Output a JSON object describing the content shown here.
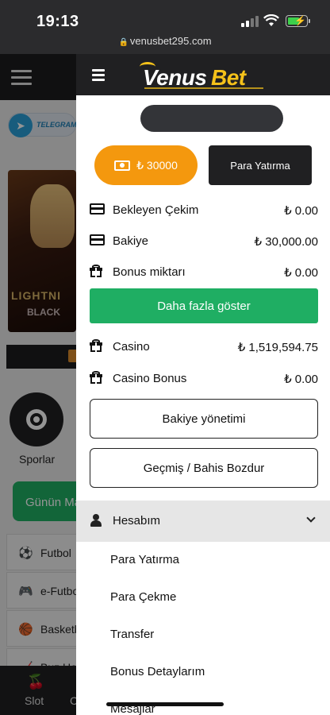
{
  "status_bar": {
    "time": "19:13",
    "url": "venusbet295.com"
  },
  "background": {
    "telegram_label": "TELEGRAM",
    "banner_text_1": "LIGHTNI",
    "banner_text_2": "BLACK",
    "sport_label": "Sporlar",
    "promo_label": "Günün Ma",
    "sport_list": [
      {
        "icon": "⚽",
        "label": "Futbol"
      },
      {
        "icon": "🎮",
        "label": "e-Futbo"
      },
      {
        "icon": "🏀",
        "label": "Basketb"
      },
      {
        "icon": "🏒",
        "label": "Buz Hok"
      }
    ],
    "bottom_nav": {
      "slot_label": "Slot",
      "c_label": "C"
    }
  },
  "drawer": {
    "logo": {
      "part1": "Venus",
      "part2": "Bet"
    },
    "balance_button": "₺ 30000",
    "deposit_button": "Para Yatırma",
    "rows": [
      {
        "icon": "card-icon",
        "label": "Bekleyen Çekim",
        "value": "₺ 0.00"
      },
      {
        "icon": "card-icon",
        "label": "Bakiye",
        "value": "₺ 30,000.00"
      },
      {
        "icon": "gift-icon",
        "label": "Bonus miktarı",
        "value": "₺ 0.00"
      }
    ],
    "more_button": "Daha fazla göster",
    "casino_rows": [
      {
        "icon": "gift-icon",
        "label": "Casino",
        "value": "₺ 1,519,594.75"
      },
      {
        "icon": "gift-icon",
        "label": "Casino Bonus",
        "value": "₺ 0.00"
      }
    ],
    "balance_management_button": "Bakiye yönetimi",
    "history_button": "Geçmiş / Bahis Bozdur",
    "account_section": "Hesabım",
    "account_links": [
      "Para Yatırma",
      "Para Çekme",
      "Transfer",
      "Bonus Detaylarım",
      "Mesajlar"
    ]
  },
  "colors": {
    "accent_orange": "#f4980e",
    "accent_green": "#1fae63",
    "brand_yellow": "#f5c21a",
    "dark": "#202022"
  }
}
